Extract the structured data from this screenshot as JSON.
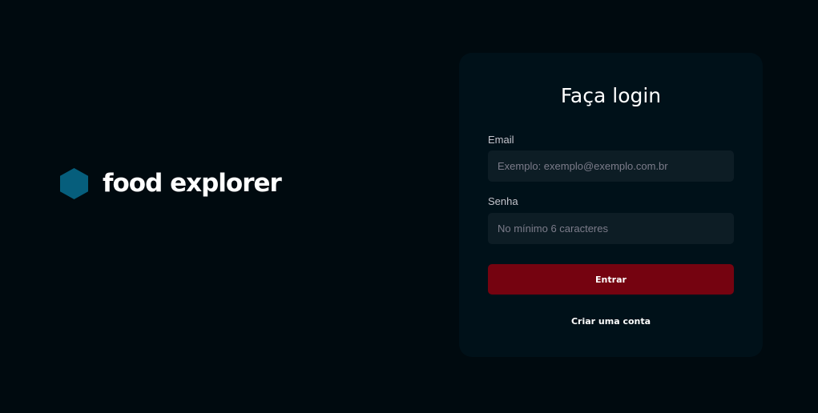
{
  "brand": {
    "name": "food explorer",
    "icon": "hexagon-icon",
    "icon_color": "#065e7c"
  },
  "login": {
    "title": "Faça login",
    "email": {
      "label": "Email",
      "value": "",
      "placeholder": "Exemplo: exemplo@exemplo.com.br"
    },
    "password": {
      "label": "Senha",
      "value": "",
      "placeholder": "No mínimo 6 caracteres"
    },
    "submit_label": "Entrar",
    "register_label": "Criar uma conta"
  },
  "colors": {
    "background": "#000a0f",
    "card": "#001119",
    "input": "#0d1d25",
    "button": "#750310",
    "label": "#c4c4cc",
    "placeholder": "#7c7c8a"
  }
}
